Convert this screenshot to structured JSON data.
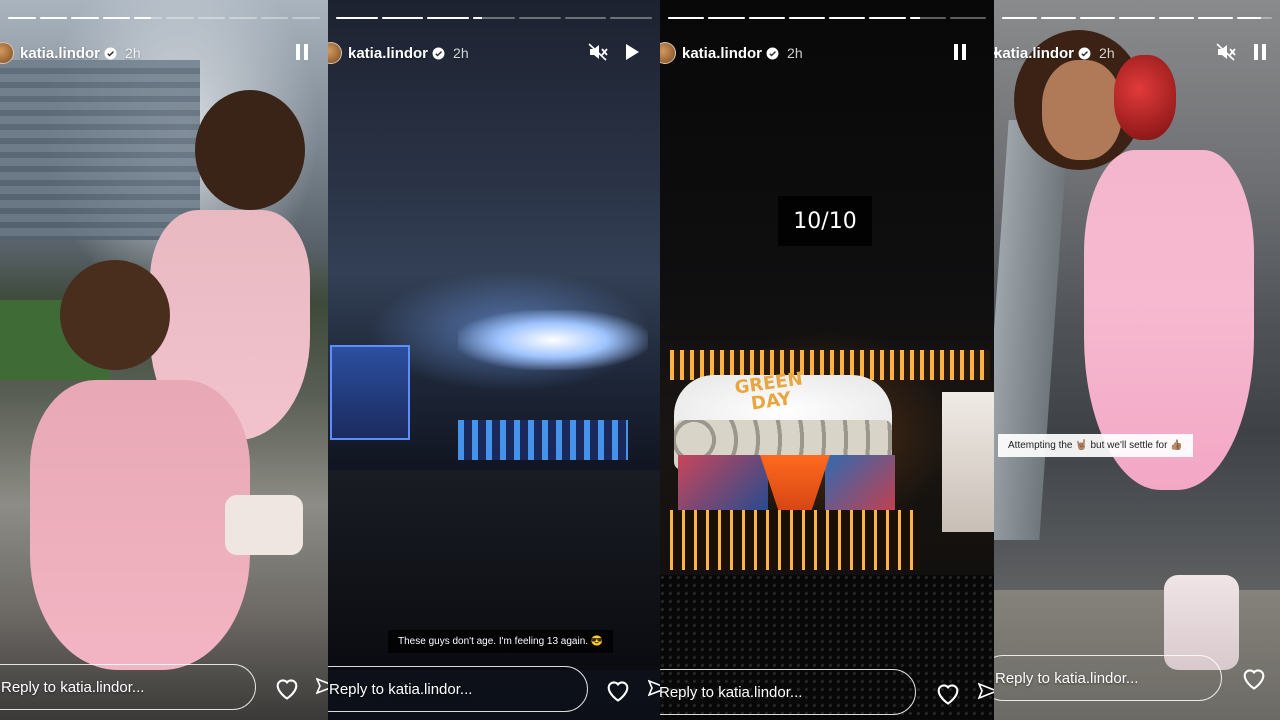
{
  "stories": [
    {
      "username": "katia.lindor",
      "time": "2h",
      "reply_placeholder": "Reply to katia.lindor...",
      "progress": [
        1,
        1,
        1,
        1,
        0.6,
        0,
        0,
        0,
        0,
        0
      ],
      "controls": [
        "pause-icon"
      ],
      "caption": ""
    },
    {
      "username": "katia.lindor",
      "time": "2h",
      "reply_placeholder": "Reply to katia.lindor...",
      "progress": [
        1,
        1,
        1,
        0.2,
        0,
        0,
        0
      ],
      "controls": [
        "mute-icon",
        "play-icon"
      ],
      "caption": "These guys don't age. I'm feeling 13 again. 😎"
    },
    {
      "username": "katia.lindor",
      "time": "2h",
      "reply_placeholder": "Reply to katia.lindor...",
      "progress": [
        1,
        1,
        1,
        1,
        1,
        1,
        0.3,
        0
      ],
      "controls": [
        "pause-icon"
      ],
      "overlay_text": "10/10",
      "stage_sign": "GREEN DAY"
    },
    {
      "username": "katia.lindor",
      "time": "2h",
      "reply_placeholder": "Reply to katia.lindor...",
      "progress": [
        1,
        1,
        1,
        1,
        1,
        1,
        0.7
      ],
      "controls": [
        "mute-icon",
        "pause-icon"
      ],
      "caption": "Attempting the 🤘🏽 but we'll settle for 👍🏽"
    }
  ],
  "colors": {
    "verified": "#3897f0",
    "text": "#ffffff"
  }
}
